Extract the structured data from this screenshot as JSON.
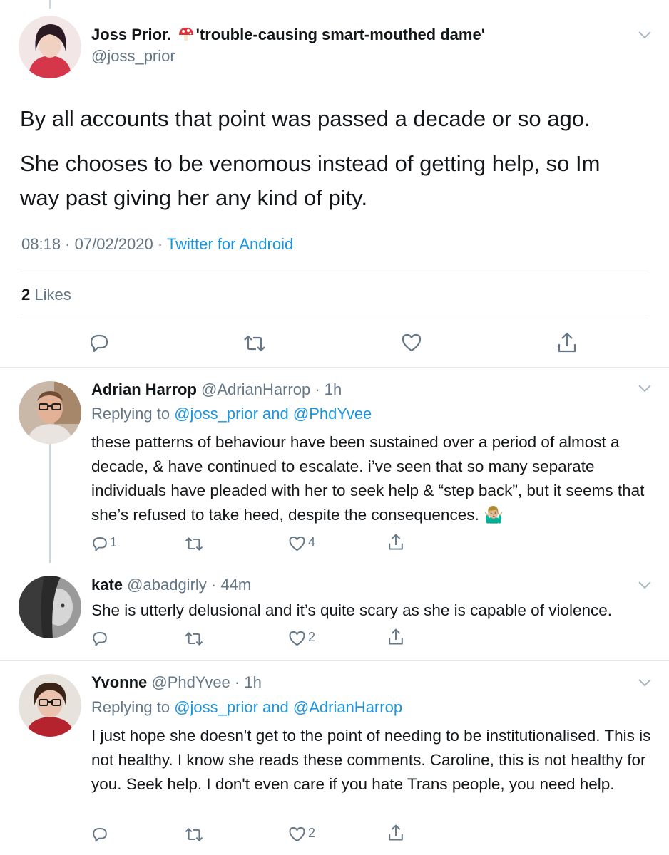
{
  "main_tweet": {
    "display_name": "Joss Prior.",
    "name_suffix": "'trouble-causing smart-mouthed dame'",
    "handle": "@joss_prior",
    "paragraph_1": "By all accounts that point was passed a decade or so ago.",
    "paragraph_2": "She chooses to be venomous instead of getting help, so Im way past giving her any kind of pity.",
    "time": "08:18",
    "date": "07/02/2020",
    "source": "Twitter for Android",
    "likes_count": "2",
    "likes_label": "Likes"
  },
  "replies": [
    {
      "display_name": "Adrian Harrop",
      "handle": "@AdrianHarrop",
      "time": "1h",
      "replying_label": "Replying to",
      "replying_to_1": "@joss_prior",
      "replying_and": "and",
      "replying_to_2": "@PhdYvee",
      "text": "these patterns of behaviour have been sustained over a period of almost a decade, & have continued to escalate. i’ve seen that so many separate individuals have pleaded with her to seek help & “step back”, but it seems that she’s refused to take heed, despite the consequences.",
      "emoji": "🤷🏼‍♂️",
      "reply_count": "1",
      "like_count": "4"
    },
    {
      "display_name": "kate",
      "handle": "@abadgirly",
      "time": "44m",
      "text": "She is utterly delusional and it’s quite scary as she is capable of violence.",
      "like_count": "2"
    },
    {
      "display_name": "Yvonne",
      "handle": "@PhdYvee",
      "time": "1h",
      "replying_label": "Replying to",
      "replying_to_1": "@joss_prior",
      "replying_and": "and",
      "replying_to_2": "@AdrianHarrop",
      "text": "I just hope she doesn't get to the point of needing to be institutionalised. This is not healthy. I know she reads these comments. Caroline, this is not healthy for you. Seek help. I don't even care if you hate Trans people, you need help.",
      "like_count": "2"
    }
  ],
  "colors": {
    "text": "#14171a",
    "secondary": "#657786",
    "link": "#1b95e0",
    "divider": "#e1e8ed",
    "thread_line": "#ccd6dd"
  },
  "icons": [
    "mushroom-emoji-icon",
    "reply-icon",
    "retweet-icon",
    "like-icon",
    "share-icon",
    "chevron-down-icon"
  ]
}
